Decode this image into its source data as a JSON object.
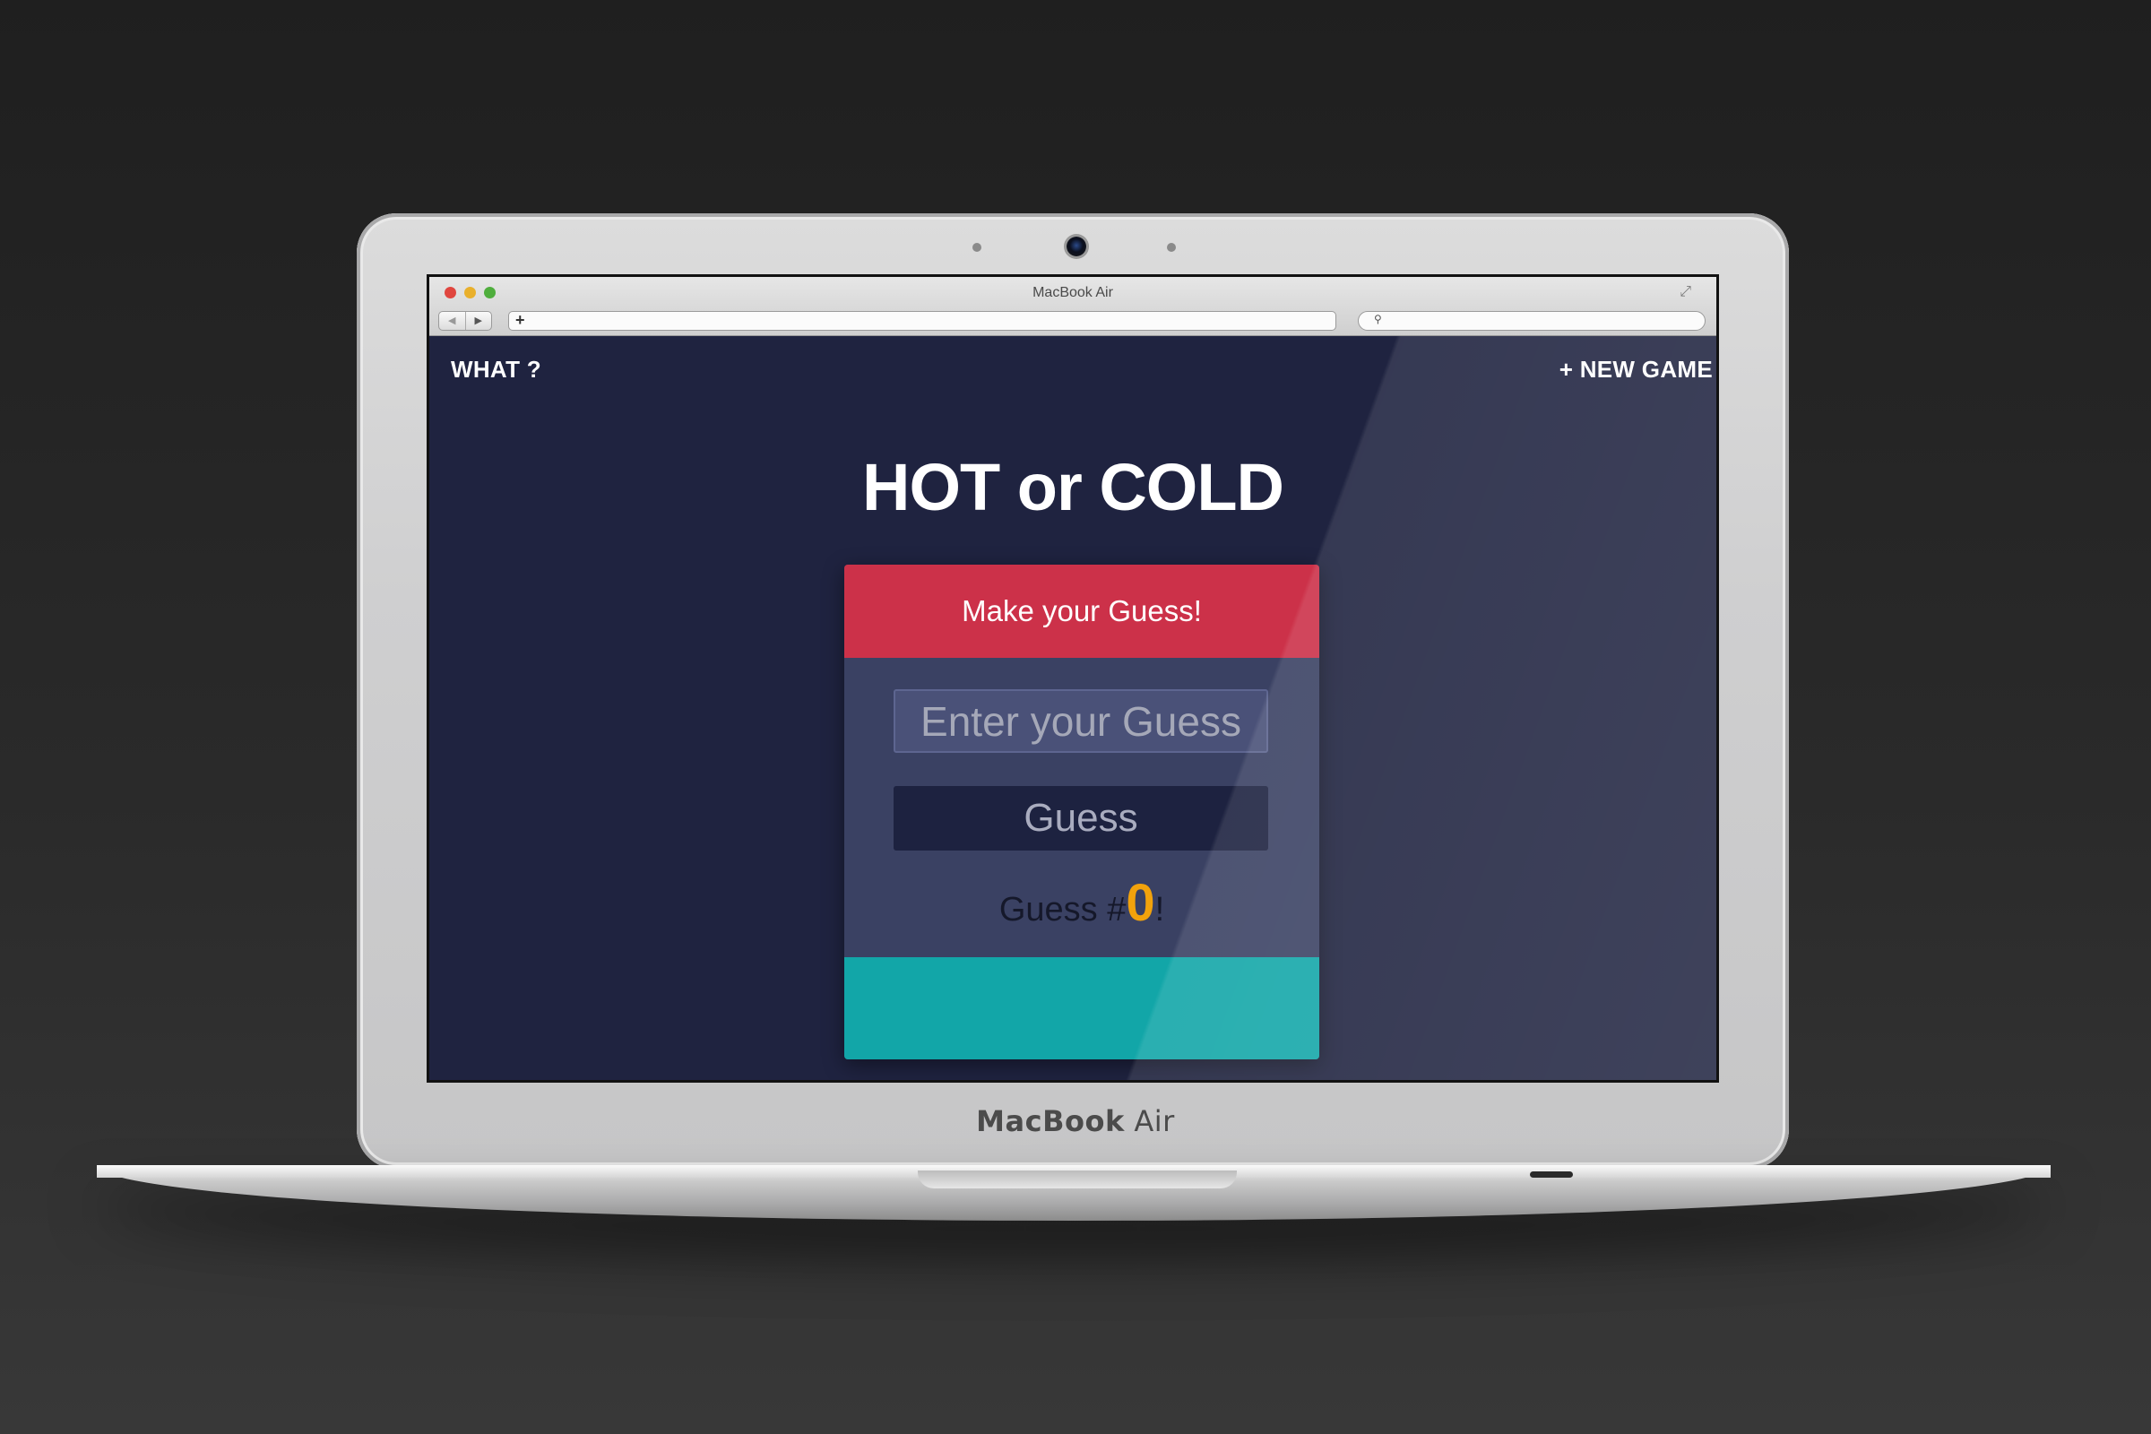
{
  "device": {
    "lid_brand_bold": "MacBook",
    "lid_brand_light": "Air"
  },
  "browser": {
    "window_title": "MacBook Air",
    "new_tab_symbol": "+",
    "search_symbol": "🔍",
    "back_symbol": "◀",
    "forward_symbol": "▶",
    "expand_symbol": "⤢"
  },
  "nav": {
    "what_label": "WHAT ?",
    "new_game_label": "+ NEW GAME"
  },
  "game": {
    "title": "HOT or COLD",
    "header_text": "Make your Guess!",
    "input_placeholder": "Enter your Guess",
    "input_value": "",
    "guess_button_label": "Guess",
    "guess_count_prefix": "Guess #",
    "guess_count_value": "0",
    "guess_count_suffix": "!",
    "feedback_text": ""
  },
  "colors": {
    "page_bg": "#1f2340",
    "card_bg": "#3a4163",
    "header_bg": "#cc3149",
    "feedback_bg": "#12a6a8",
    "count_accent": "#f2a20c"
  }
}
